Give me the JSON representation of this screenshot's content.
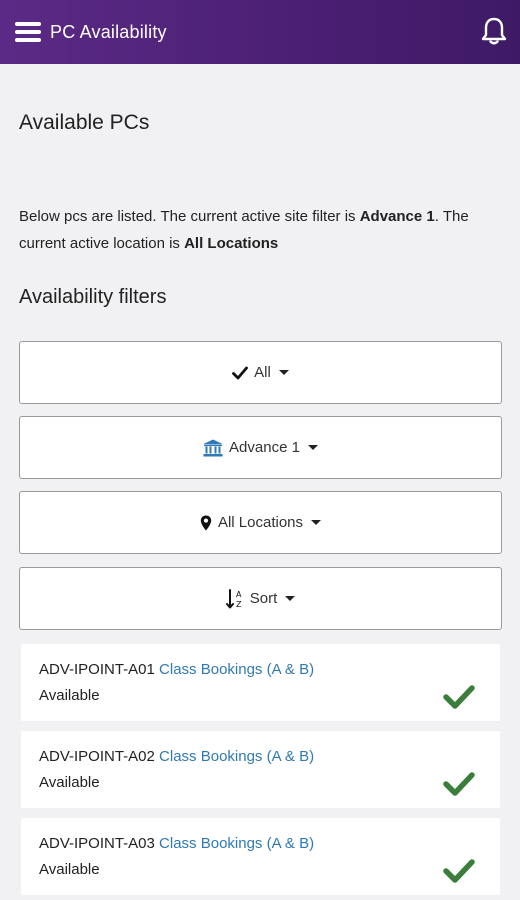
{
  "appbar": {
    "title": "PC Availability",
    "menu_icon": "hamburger-menu-icon",
    "bell_icon": "bell-icon",
    "colors": {
      "start": "#5b2a86",
      "end": "#3e1a66"
    }
  },
  "page": {
    "title": "Available PCs",
    "desc_prefix": "Below pcs are listed. The current active site filter is ",
    "site": "Advance 1",
    "desc_mid": ". The current active location is ",
    "location": "All Locations",
    "filters_title": "Availability filters"
  },
  "filters": [
    {
      "label": "All",
      "icon": "check-icon"
    },
    {
      "label": "Advance 1",
      "icon": "bank-icon"
    },
    {
      "label": "All Locations",
      "icon": "map-marker-icon"
    },
    {
      "label": "Sort",
      "icon": "sort-alpha-icon"
    }
  ],
  "pcs": [
    {
      "name": "ADV-IPOINT-A01",
      "group": "Class Bookings (A & B)",
      "status": "Available"
    },
    {
      "name": "ADV-IPOINT-A02",
      "group": "Class Bookings (A & B)",
      "status": "Available"
    },
    {
      "name": "ADV-IPOINT-A03",
      "group": "Class Bookings (A & B)",
      "status": "Available"
    }
  ],
  "colors": {
    "link": "#2f7ab5",
    "check": "#3b7d3b",
    "bank_icon": "#2f7ab5"
  }
}
